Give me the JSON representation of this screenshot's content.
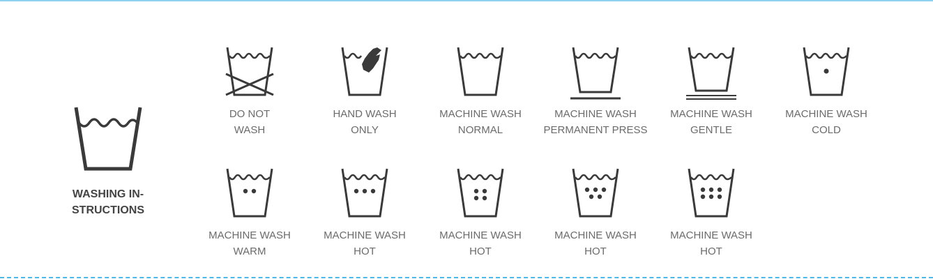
{
  "colors": {
    "icon": "#3a3a3a",
    "label": "#6b6b6b",
    "heading": "#444444",
    "dash": "#4fb7e6"
  },
  "main": {
    "label_line1": "WASHING IN-",
    "label_line2": "STRUCTIONS"
  },
  "items": [
    {
      "line1": "DO NOT",
      "line2": "WASH",
      "icon": "do-not-wash-icon"
    },
    {
      "line1": "HAND WASH",
      "line2": "ONLY",
      "icon": "hand-wash-icon"
    },
    {
      "line1": "MACHINE WASH",
      "line2": "NORMAL",
      "icon": "machine-wash-normal-icon"
    },
    {
      "line1": "MACHINE WASH",
      "line2": "PERMANENT PRESS",
      "icon": "machine-wash-permanent-press-icon"
    },
    {
      "line1": "MACHINE WASH",
      "line2": "GENTLE",
      "icon": "machine-wash-gentle-icon"
    },
    {
      "line1": "MACHINE WASH",
      "line2": "COLD",
      "icon": "machine-wash-cold-icon"
    },
    {
      "line1": "MACHINE WASH",
      "line2": "WARM",
      "icon": "machine-wash-warm-icon"
    },
    {
      "line1": "MACHINE WASH",
      "line2": "HOT",
      "icon": "machine-wash-hot-3-dots-icon"
    },
    {
      "line1": "MACHINE WASH",
      "line2": "HOT",
      "icon": "machine-wash-hot-4-dots-icon"
    },
    {
      "line1": "MACHINE WASH",
      "line2": "HOT",
      "icon": "machine-wash-hot-5-dots-icon"
    },
    {
      "line1": "MACHINE WASH",
      "line2": "HOT",
      "icon": "machine-wash-hot-6-dots-icon"
    }
  ]
}
